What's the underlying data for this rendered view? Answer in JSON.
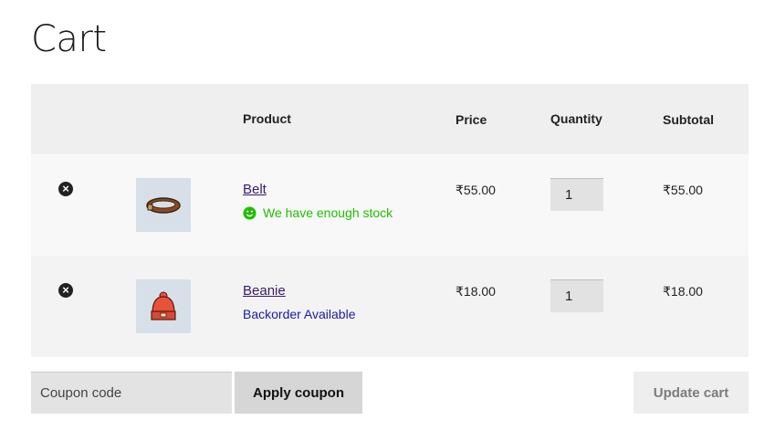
{
  "page": {
    "title": "Cart"
  },
  "table": {
    "headers": {
      "product": "Product",
      "price": "Price",
      "quantity": "Quantity",
      "subtotal": "Subtotal"
    },
    "items": [
      {
        "remove_icon": "×",
        "name": "Belt",
        "stock_message": "We have enough stock",
        "price": "₹55.00",
        "quantity": "1",
        "subtotal": "₹55.00"
      },
      {
        "remove_icon": "×",
        "name": "Beanie",
        "stock_message": "Backorder Available",
        "price": "₹18.00",
        "quantity": "1",
        "subtotal": "₹18.00"
      }
    ]
  },
  "actions": {
    "coupon_placeholder": "Coupon code",
    "apply_label": "Apply coupon",
    "update_label": "Update cart"
  },
  "colors": {
    "in_stock": "#1fbf00",
    "backorder": "#1a1aa8",
    "link": "#3a1a6e"
  }
}
